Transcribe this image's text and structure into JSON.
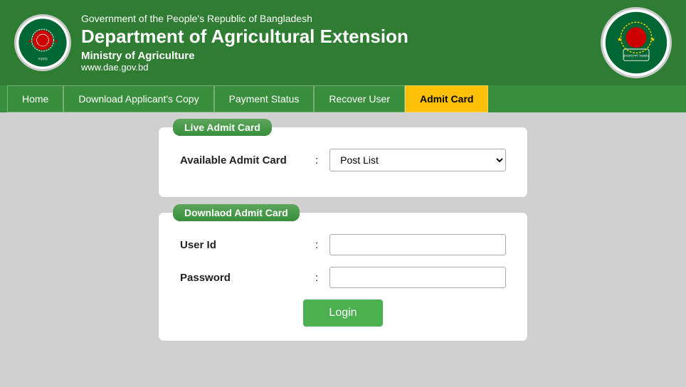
{
  "header": {
    "gov_title": "Government of the People's Republic of Bangladesh",
    "dept_title": "Department of Agricultural Extension",
    "ministry": "Ministry of Agriculture",
    "website": "www.dae.gov.bd"
  },
  "navbar": {
    "items": [
      {
        "id": "home",
        "label": "Home",
        "active": false
      },
      {
        "id": "download",
        "label": "Download Applicant's Copy",
        "active": false
      },
      {
        "id": "payment",
        "label": "Payment Status",
        "active": false
      },
      {
        "id": "recover",
        "label": "Recover User",
        "active": false
      },
      {
        "id": "admit",
        "label": "Admit Card",
        "active": true
      }
    ]
  },
  "live_card": {
    "legend": "Live Admit Card",
    "label": "Available Admit Card",
    "colon": ":",
    "select_default": "Post List",
    "select_options": [
      "Post List"
    ]
  },
  "download_card": {
    "legend": "Downlaod Admit Card",
    "user_id_label": "User Id",
    "password_label": "Password",
    "colon": ":",
    "login_btn": "Login"
  }
}
